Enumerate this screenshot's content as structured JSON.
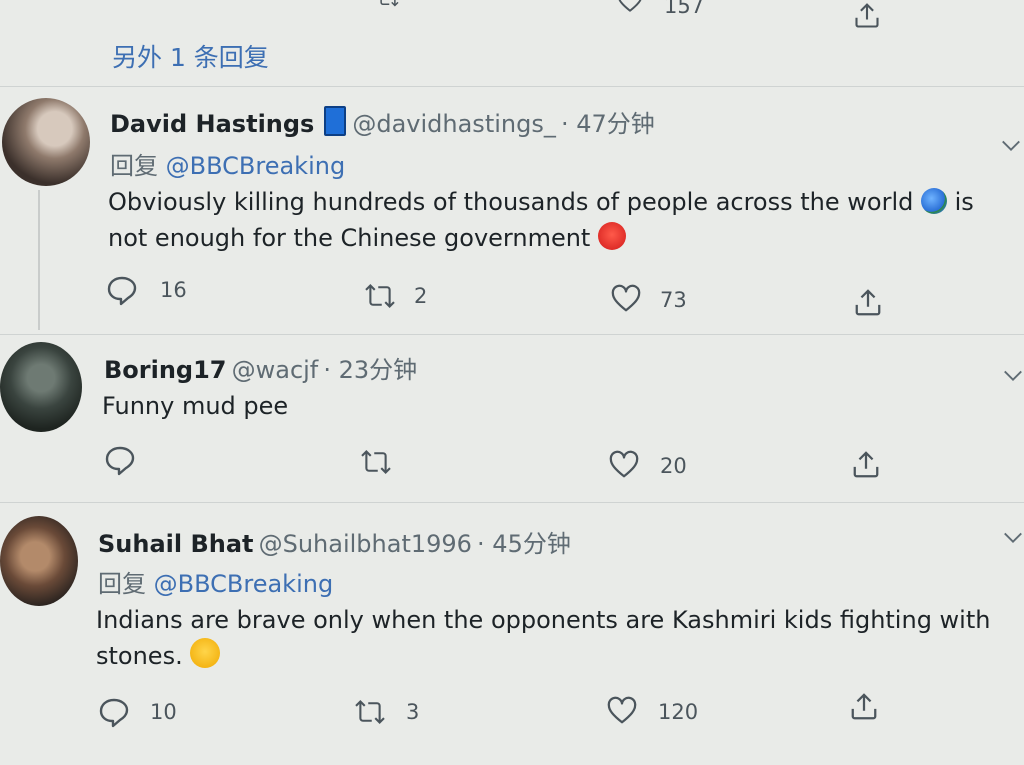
{
  "top_partial": {
    "like_count": "157"
  },
  "more_replies_label": "另外 1 条回复",
  "tweets": [
    {
      "name": "David Hastings",
      "handle": "@davidhastings_",
      "time": "· 47分钟",
      "reply_prefix": "回复",
      "reply_to": "@BBCBreaking",
      "text_line1": "Obviously killing hundreds of thousands of people across the world",
      "text_line1_end": "is",
      "text_line2": "not enough for the Chinese government",
      "reply_count": "16",
      "retweet_count": "2",
      "like_count": "73"
    },
    {
      "name": "Boring17",
      "handle": "@wacjf",
      "time": "· 23分钟",
      "text_line1": "Funny mud pee",
      "reply_count": "",
      "retweet_count": "",
      "like_count": "20"
    },
    {
      "name": "Suhail Bhat",
      "handle": "@Suhailbhat1996",
      "time": "· 45分钟",
      "reply_prefix": "回复",
      "reply_to": "@BBCBreaking",
      "text_line1": "Indians are brave only when the opponents are Kashmiri kids fighting with",
      "text_line2": "stones.",
      "reply_count": "10",
      "retweet_count": "3",
      "like_count": "120"
    }
  ],
  "icons": {
    "reply": "reply-icon",
    "retweet": "retweet-icon",
    "like": "heart-icon",
    "share": "share-icon",
    "more": "chevron-down-icon",
    "verified_like_badge": "phone-badge-icon",
    "globe": "globe-emoji",
    "angry": "angry-face-emoji",
    "laugh": "tears-of-joy-emoji"
  },
  "colors": {
    "link": "#3d6fb3",
    "text": "#1d2327",
    "muted": "#5f6b73"
  }
}
